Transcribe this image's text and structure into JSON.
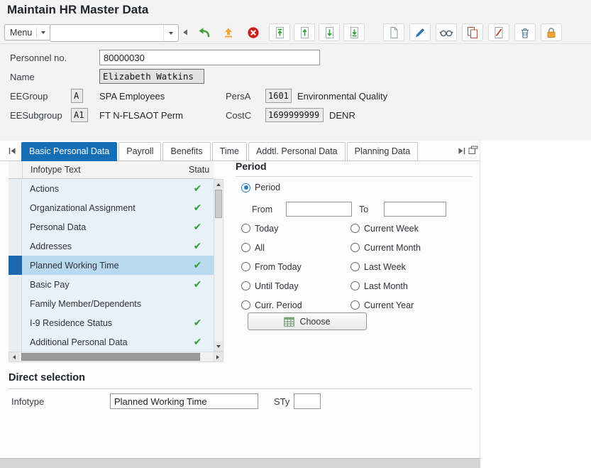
{
  "window": {
    "title": "Maintain HR Master Data"
  },
  "colors": {
    "active_tab": "#156fb7",
    "selected_row": "#b9d9ee",
    "selection_bar": "#1b69ac",
    "check_green": "#2f9e33"
  },
  "icons": {
    "toolbar": [
      "back",
      "exit",
      "cancel",
      "first-page",
      "previous-page",
      "next-page",
      "last-page",
      "create",
      "change",
      "display",
      "copy",
      "delimit",
      "delete",
      "lock"
    ],
    "tabstrip": [
      "scroll-tabs-left",
      "scroll-tabs-right",
      "expand-tabstrip"
    ],
    "choose_button": "calendar",
    "status_column": "green-checkmark"
  },
  "toolbar": {
    "menu_label": "Menu",
    "command_value": ""
  },
  "header_form": {
    "personnel_no_label": "Personnel no.",
    "personnel_no_value": "80000030",
    "name_label": "Name",
    "name_value": "Elizabeth Watkins",
    "ee_group_label": "EEGroup",
    "ee_group_value": "A",
    "ee_group_text": "SPA Employees",
    "pers_a_label": "PersA",
    "pers_a_value": "1601",
    "pers_a_text": "Environmental Quality",
    "ee_subgroup_label": "EESubgroup",
    "ee_subgroup_value": "A1",
    "ee_subgroup_text": "FT N-FLSAOT Perm",
    "cost_c_label": "CostC",
    "cost_c_value": "1699999999",
    "cost_c_text": "DENR"
  },
  "tabs": {
    "items": [
      {
        "label": "Basic Personal Data",
        "active": true
      },
      {
        "label": "Payroll",
        "active": false
      },
      {
        "label": "Benefits",
        "active": false
      },
      {
        "label": "Time",
        "active": false
      },
      {
        "label": "Addtl. Personal Data",
        "active": false
      },
      {
        "label": "Planning Data",
        "active": false
      }
    ]
  },
  "infotype_list": {
    "col_infotype": "Infotype Text",
    "col_status": "Statu",
    "rows": [
      {
        "text": "Actions",
        "status": "✔",
        "selected": false
      },
      {
        "text": "Organizational Assignment",
        "status": "✔",
        "selected": false
      },
      {
        "text": "Personal Data",
        "status": "✔",
        "selected": false
      },
      {
        "text": "Addresses",
        "status": "✔",
        "selected": false
      },
      {
        "text": "Planned Working Time",
        "status": "✔",
        "selected": true
      },
      {
        "text": "Basic Pay",
        "status": "✔",
        "selected": false
      },
      {
        "text": "Family Member/Dependents",
        "status": "",
        "selected": false
      },
      {
        "text": "I-9 Residence Status",
        "status": "✔",
        "selected": false
      },
      {
        "text": "Additional Personal Data",
        "status": "✔",
        "selected": false
      }
    ]
  },
  "period": {
    "title": "Period",
    "radio_period": "Period",
    "from_label": "From",
    "from_value": "",
    "to_label": "To",
    "to_value": "",
    "left_options": [
      "Today",
      "All",
      "From Today",
      "Until Today",
      "Curr. Period"
    ],
    "right_options": [
      "Current Week",
      "Current Month",
      "Last Week",
      "Last Month",
      "Current Year"
    ],
    "choose_label": "Choose"
  },
  "direct_selection": {
    "title": "Direct selection",
    "infotype_label": "Infotype",
    "infotype_value": "Planned Working Time",
    "sty_label": "STy",
    "sty_value": ""
  }
}
